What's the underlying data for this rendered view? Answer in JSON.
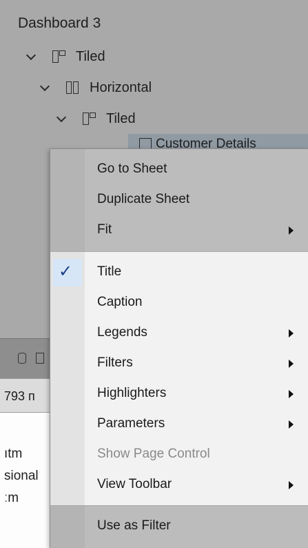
{
  "background": {
    "dashboard_title": "Dashboard 3",
    "tree": [
      {
        "label": "Tiled",
        "icon": "tiled-container-icon"
      },
      {
        "label": "Horizontal",
        "icon": "horizontal-container-icon"
      },
      {
        "label": "Tiled",
        "icon": "tiled-container-icon"
      }
    ],
    "selected_item": "Customer Details",
    "size_text": "793 п",
    "left_items": [
      "ıtm",
      "sional",
      "ːm"
    ]
  },
  "menu": {
    "sections": [
      [
        {
          "label": "Go to Sheet"
        },
        {
          "label": "Duplicate Sheet"
        },
        {
          "label": "Fit",
          "submenu": true
        }
      ],
      [
        {
          "label": "Title",
          "checked": true
        },
        {
          "label": "Caption"
        },
        {
          "label": "Legends",
          "submenu": true
        },
        {
          "label": "Filters",
          "submenu": true
        },
        {
          "label": "Highlighters",
          "submenu": true
        },
        {
          "label": "Parameters",
          "submenu": true
        },
        {
          "label": "Show Page Control",
          "disabled": true
        },
        {
          "label": "View Toolbar",
          "submenu": true
        }
      ],
      [
        {
          "label": "Use as Filter"
        }
      ]
    ],
    "check_glyph": "✓"
  },
  "colors": {
    "check": "#1c3e86",
    "dim_background": "#a9a9a9",
    "menu_bg": "#f2f2f2"
  }
}
